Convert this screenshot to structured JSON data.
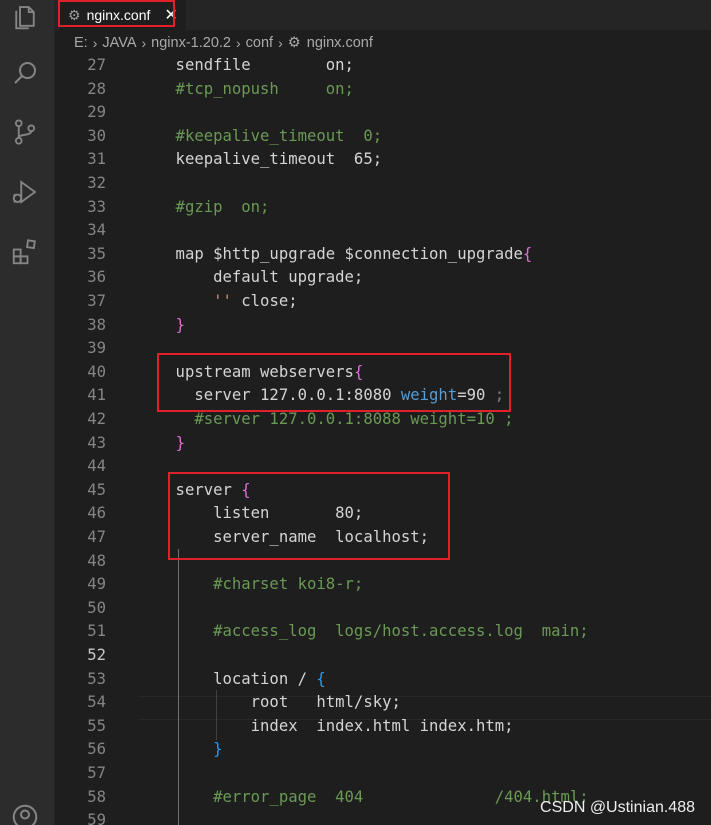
{
  "tab": {
    "title": "nginx.conf",
    "icon": "gear-icon",
    "close_glyph": "✕"
  },
  "breadcrumb": {
    "items": [
      "E:",
      "JAVA",
      "nginx-1.20.2",
      "conf",
      "nginx.conf"
    ]
  },
  "editor": {
    "active_line": 52,
    "lines": [
      {
        "n": "27",
        "tokens": [
          {
            "t": "    sendfile        on;",
            "c": "ident"
          }
        ]
      },
      {
        "n": "28",
        "tokens": [
          {
            "t": "    #tcp_nopush     on;",
            "c": "comment"
          }
        ]
      },
      {
        "n": "29",
        "tokens": []
      },
      {
        "n": "30",
        "tokens": [
          {
            "t": "    #keepalive_timeout  0;",
            "c": "comment"
          }
        ]
      },
      {
        "n": "31",
        "tokens": [
          {
            "t": "    keepalive_timeout  65;",
            "c": "ident"
          }
        ]
      },
      {
        "n": "32",
        "tokens": []
      },
      {
        "n": "33",
        "tokens": [
          {
            "t": "    #gzip  on;",
            "c": "comment"
          }
        ]
      },
      {
        "n": "34",
        "tokens": []
      },
      {
        "n": "35",
        "tokens": [
          {
            "t": "    map $http_upgrade $connection_upgrade",
            "c": "ident"
          },
          {
            "t": "{",
            "c": "brace1"
          }
        ]
      },
      {
        "n": "36",
        "tokens": [
          {
            "t": "        default upgrade;",
            "c": "ident"
          }
        ]
      },
      {
        "n": "37",
        "tokens": [
          {
            "t": "        ",
            "c": "ident"
          },
          {
            "t": "''",
            "c": "str"
          },
          {
            "t": " close;",
            "c": "ident"
          }
        ]
      },
      {
        "n": "38",
        "tokens": [
          {
            "t": "    ",
            "c": "ident"
          },
          {
            "t": "}",
            "c": "brace1"
          }
        ]
      },
      {
        "n": "39",
        "tokens": []
      },
      {
        "n": "40",
        "tokens": [
          {
            "t": "    upstream webservers",
            "c": "ident"
          },
          {
            "t": "{",
            "c": "brace1"
          }
        ]
      },
      {
        "n": "41",
        "tokens": [
          {
            "t": "      server 127.0.0.1:8080 ",
            "c": "ident"
          },
          {
            "t": "weight",
            "c": "key"
          },
          {
            "t": "=90 ",
            "c": "ident"
          },
          {
            "t": ";",
            "c": "faint"
          }
        ]
      },
      {
        "n": "42",
        "tokens": [
          {
            "t": "      #server 127.0.0.1:8088 weight=10 ;",
            "c": "comment"
          }
        ]
      },
      {
        "n": "43",
        "tokens": [
          {
            "t": "    ",
            "c": "ident"
          },
          {
            "t": "}",
            "c": "brace1"
          }
        ]
      },
      {
        "n": "44",
        "tokens": []
      },
      {
        "n": "45",
        "tokens": [
          {
            "t": "    server ",
            "c": "ident"
          },
          {
            "t": "{",
            "c": "brace1"
          }
        ]
      },
      {
        "n": "46",
        "tokens": [
          {
            "t": "        listen       80;",
            "c": "ident"
          }
        ]
      },
      {
        "n": "47",
        "tokens": [
          {
            "t": "        server_name  localhost;",
            "c": "ident"
          }
        ]
      },
      {
        "n": "48",
        "tokens": []
      },
      {
        "n": "49",
        "tokens": [
          {
            "t": "        #charset koi8-r;",
            "c": "comment"
          }
        ]
      },
      {
        "n": "50",
        "tokens": []
      },
      {
        "n": "51",
        "tokens": [
          {
            "t": "        #access_log  logs/host.access.log  main;",
            "c": "comment"
          }
        ]
      },
      {
        "n": "52",
        "tokens": []
      },
      {
        "n": "53",
        "tokens": [
          {
            "t": "        location / ",
            "c": "ident"
          },
          {
            "t": "{",
            "c": "brace2"
          }
        ]
      },
      {
        "n": "54",
        "tokens": [
          {
            "t": "            root   html/sky;",
            "c": "ident"
          }
        ]
      },
      {
        "n": "55",
        "tokens": [
          {
            "t": "            index  index.html index.htm;",
            "c": "ident"
          }
        ]
      },
      {
        "n": "56",
        "tokens": [
          {
            "t": "        ",
            "c": "ident"
          },
          {
            "t": "}",
            "c": "brace2"
          }
        ]
      },
      {
        "n": "57",
        "tokens": []
      },
      {
        "n": "58",
        "tokens": [
          {
            "t": "        #error_page  404              /404.html;",
            "c": "comment"
          }
        ]
      },
      {
        "n": "59",
        "tokens": []
      }
    ]
  },
  "watermark": "CSDN @Ustinian.488",
  "colors": {
    "highlight_box": "#e0202a",
    "comment": "#6a9955",
    "keyword": "#569cd6",
    "brace_purple": "#da70d6",
    "brace_blue": "#179fff",
    "string": "#ce9178",
    "text": "#d4d4d4",
    "line_number": "#858585"
  },
  "activity_bar": {
    "icons": [
      "files-icon",
      "search-icon",
      "source-control-icon",
      "run-debug-icon",
      "extensions-icon",
      "account-icon"
    ]
  }
}
